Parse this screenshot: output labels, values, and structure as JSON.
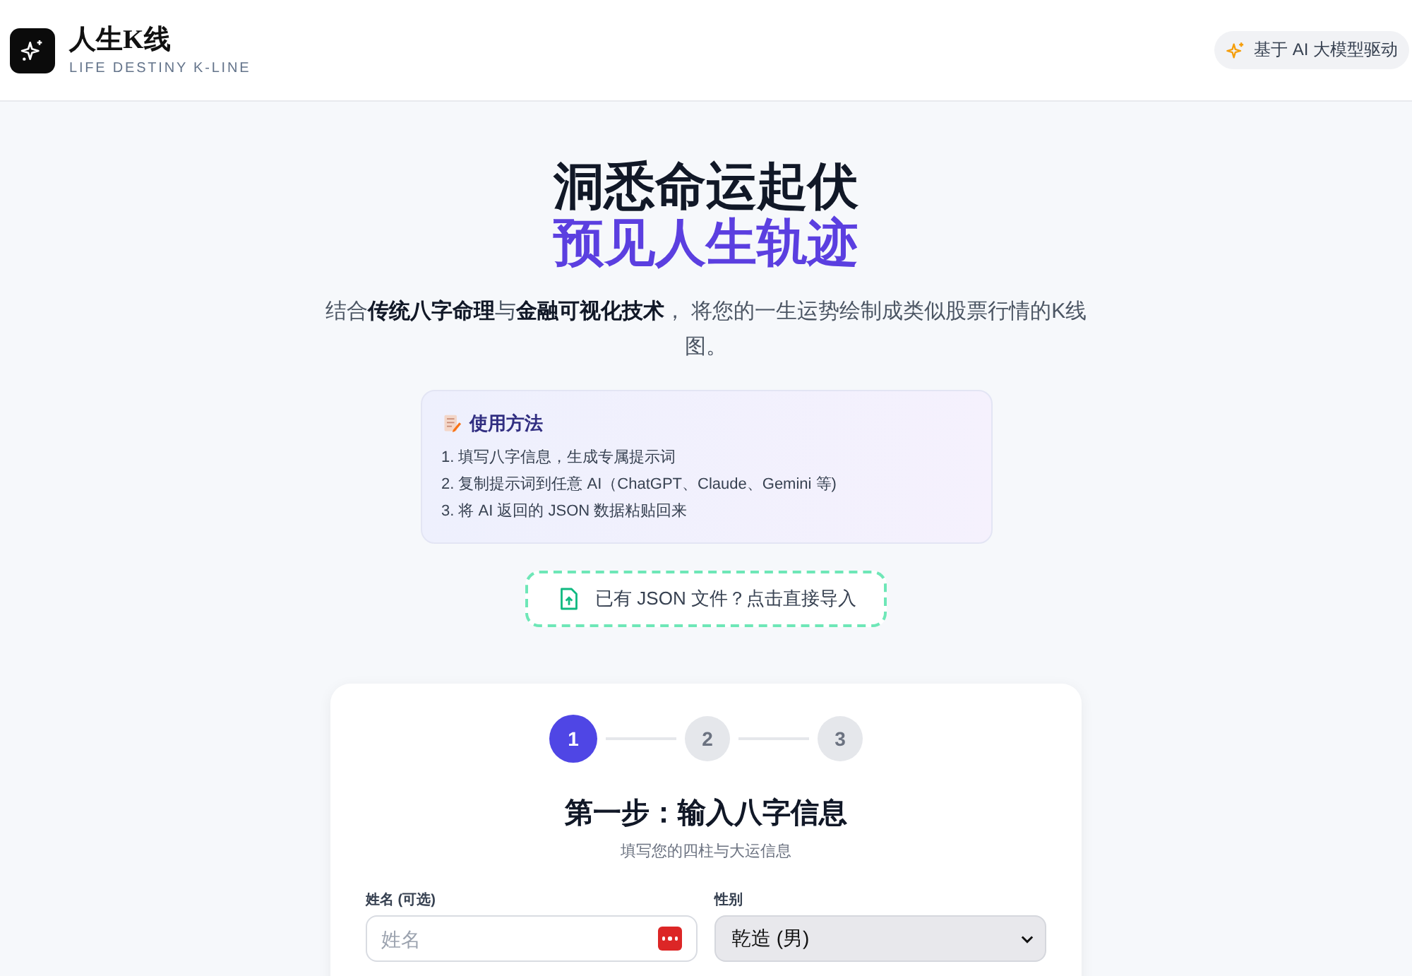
{
  "header": {
    "logo_title": "人生K线",
    "logo_subtitle": "LIFE DESTINY K-LINE",
    "badge": "基于 AI 大模型驱动"
  },
  "hero": {
    "title_line1": "洞悉命运起伏",
    "title_line2": "预见人生轨迹",
    "subtitle": "结合**传统八字命理**与**金融可视化技术**， 将您的一生运势绘制成类似股票行情的K线图。"
  },
  "usage": {
    "title": "使用方法",
    "steps": [
      "1. 填写八字信息，生成专属提示词",
      "2. 复制提示词到任意 AI（ChatGPT、Claude、Gemini 等)",
      "3. 将 AI 返回的 JSON 数据粘贴回来"
    ]
  },
  "import_button": "已有 JSON 文件？点击直接导入",
  "form": {
    "steps": [
      {
        "label": "1",
        "selected": true
      },
      {
        "label": "2",
        "selected": false
      },
      {
        "label": "3",
        "selected": false
      }
    ],
    "title": "第一步：输入八字信息",
    "subtitle": "填写您的四柱与大运信息",
    "name_label": "姓名 (可选)",
    "name_placeholder": "姓名",
    "gender_label": "性别",
    "gender_value": "乾造 (男)"
  }
}
